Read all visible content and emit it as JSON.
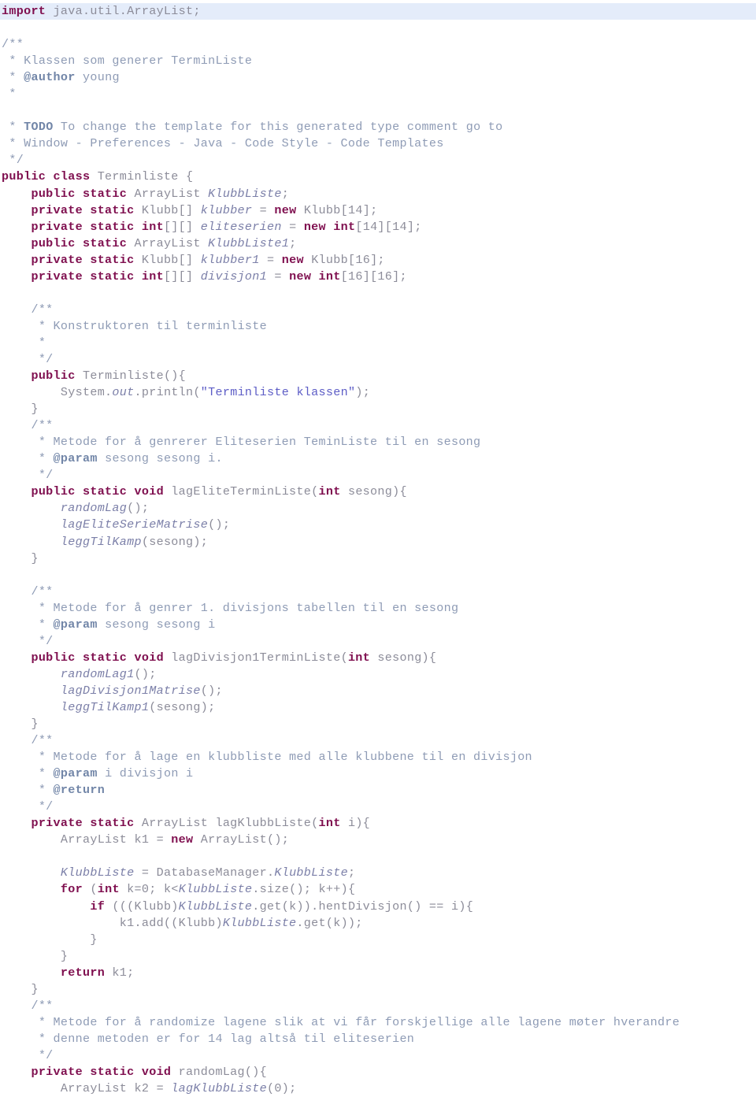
{
  "document": {
    "kind": "java-source-listing",
    "language": "Java",
    "class_name": "Terminliste",
    "author": "young",
    "colors": {
      "background": "#ffffff",
      "highlight_line": "#e4ecfa",
      "keyword": "#7f0f4f",
      "plain": "#8c8c99",
      "field_italic": "#7b7fa8",
      "comment": "#8e9bb5",
      "comment_tag": "#7286a8",
      "string": "#5d5dc6"
    },
    "highlighted_line_index": 0
  },
  "lines": [
    {
      "i": 0,
      "hl": true,
      "tokens": [
        {
          "t": "kw",
          "v": "import"
        },
        {
          "t": "pln",
          "v": " java.util.ArrayList;"
        }
      ]
    },
    {
      "i": 1,
      "tokens": []
    },
    {
      "i": 2,
      "tokens": [
        {
          "t": "cmt",
          "v": "/**"
        }
      ]
    },
    {
      "i": 3,
      "tokens": [
        {
          "t": "cmt",
          "v": " * Klassen som generer TerminListe"
        }
      ]
    },
    {
      "i": 4,
      "tokens": [
        {
          "t": "cmt",
          "v": " * "
        },
        {
          "t": "cmtb",
          "v": "@author"
        },
        {
          "t": "cmt",
          "v": " young"
        }
      ]
    },
    {
      "i": 5,
      "tokens": [
        {
          "t": "cmt",
          "v": " *"
        }
      ]
    },
    {
      "i": 6,
      "tokens": []
    },
    {
      "i": 7,
      "tokens": [
        {
          "t": "cmt",
          "v": " * "
        },
        {
          "t": "cmtb",
          "v": "TODO"
        },
        {
          "t": "cmt",
          "v": " To change the template for this generated type comment go to"
        }
      ]
    },
    {
      "i": 8,
      "tokens": [
        {
          "t": "cmt",
          "v": " * Window - Preferences - Java - Code Style - Code Templates"
        }
      ]
    },
    {
      "i": 9,
      "tokens": [
        {
          "t": "cmt",
          "v": " */"
        }
      ]
    },
    {
      "i": 10,
      "tokens": [
        {
          "t": "kw",
          "v": "public class"
        },
        {
          "t": "pln",
          "v": " Terminliste {"
        }
      ]
    },
    {
      "i": 11,
      "tokens": [
        {
          "t": "pln",
          "v": "    "
        },
        {
          "t": "kw",
          "v": "public static"
        },
        {
          "t": "pln",
          "v": " ArrayList "
        },
        {
          "t": "fld",
          "v": "KlubbListe"
        },
        {
          "t": "pln",
          "v": ";"
        }
      ]
    },
    {
      "i": 12,
      "tokens": [
        {
          "t": "pln",
          "v": "    "
        },
        {
          "t": "kw",
          "v": "private static"
        },
        {
          "t": "pln",
          "v": " Klubb[] "
        },
        {
          "t": "fld",
          "v": "klubber"
        },
        {
          "t": "pln",
          "v": " = "
        },
        {
          "t": "kw",
          "v": "new"
        },
        {
          "t": "pln",
          "v": " Klubb[14];"
        }
      ]
    },
    {
      "i": 13,
      "tokens": [
        {
          "t": "pln",
          "v": "    "
        },
        {
          "t": "kw",
          "v": "private static int"
        },
        {
          "t": "pln",
          "v": "[][] "
        },
        {
          "t": "fld",
          "v": "eliteserien"
        },
        {
          "t": "pln",
          "v": " = "
        },
        {
          "t": "kw",
          "v": "new int"
        },
        {
          "t": "pln",
          "v": "[14][14];"
        }
      ]
    },
    {
      "i": 14,
      "tokens": [
        {
          "t": "pln",
          "v": "    "
        },
        {
          "t": "kw",
          "v": "public static"
        },
        {
          "t": "pln",
          "v": " ArrayList "
        },
        {
          "t": "fld",
          "v": "KlubbListe1"
        },
        {
          "t": "pln",
          "v": ";"
        }
      ]
    },
    {
      "i": 15,
      "tokens": [
        {
          "t": "pln",
          "v": "    "
        },
        {
          "t": "kw",
          "v": "private static"
        },
        {
          "t": "pln",
          "v": " Klubb[] "
        },
        {
          "t": "fld",
          "v": "klubber1"
        },
        {
          "t": "pln",
          "v": " = "
        },
        {
          "t": "kw",
          "v": "new"
        },
        {
          "t": "pln",
          "v": " Klubb[16];"
        }
      ]
    },
    {
      "i": 16,
      "tokens": [
        {
          "t": "pln",
          "v": "    "
        },
        {
          "t": "kw",
          "v": "private static int"
        },
        {
          "t": "pln",
          "v": "[][] "
        },
        {
          "t": "fld",
          "v": "divisjon1"
        },
        {
          "t": "pln",
          "v": " = "
        },
        {
          "t": "kw",
          "v": "new int"
        },
        {
          "t": "pln",
          "v": "[16][16];"
        }
      ]
    },
    {
      "i": 17,
      "tokens": []
    },
    {
      "i": 18,
      "tokens": [
        {
          "t": "cmt",
          "v": "    /**"
        }
      ]
    },
    {
      "i": 19,
      "tokens": [
        {
          "t": "cmt",
          "v": "     * Konstruktoren til terminliste"
        }
      ]
    },
    {
      "i": 20,
      "tokens": [
        {
          "t": "cmt",
          "v": "     *"
        }
      ]
    },
    {
      "i": 21,
      "tokens": [
        {
          "t": "cmt",
          "v": "     */"
        }
      ]
    },
    {
      "i": 22,
      "tokens": [
        {
          "t": "pln",
          "v": "    "
        },
        {
          "t": "kw",
          "v": "public"
        },
        {
          "t": "pln",
          "v": " Terminliste(){"
        }
      ]
    },
    {
      "i": 23,
      "tokens": [
        {
          "t": "pln",
          "v": "        System."
        },
        {
          "t": "fld",
          "v": "out"
        },
        {
          "t": "pln",
          "v": ".println("
        },
        {
          "t": "str",
          "v": "\"Terminliste klassen\""
        },
        {
          "t": "pln",
          "v": ");"
        }
      ]
    },
    {
      "i": 24,
      "tokens": [
        {
          "t": "pln",
          "v": "    }"
        }
      ]
    },
    {
      "i": 25,
      "tokens": [
        {
          "t": "cmt",
          "v": "    /**"
        }
      ]
    },
    {
      "i": 26,
      "tokens": [
        {
          "t": "cmt",
          "v": "     * Metode for å genrerer Eliteserien TeminListe til en sesong"
        }
      ]
    },
    {
      "i": 27,
      "tokens": [
        {
          "t": "cmt",
          "v": "     * "
        },
        {
          "t": "cmtb",
          "v": "@param"
        },
        {
          "t": "cmt",
          "v": " sesong sesong i."
        }
      ]
    },
    {
      "i": 28,
      "tokens": [
        {
          "t": "cmt",
          "v": "     */"
        }
      ]
    },
    {
      "i": 29,
      "tokens": [
        {
          "t": "pln",
          "v": "    "
        },
        {
          "t": "kw",
          "v": "public static void"
        },
        {
          "t": "pln",
          "v": " lagEliteTerminListe("
        },
        {
          "t": "kw",
          "v": "int"
        },
        {
          "t": "pln",
          "v": " sesong){"
        }
      ]
    },
    {
      "i": 30,
      "tokens": [
        {
          "t": "pln",
          "v": "        "
        },
        {
          "t": "fld",
          "v": "randomLag"
        },
        {
          "t": "pln",
          "v": "();"
        }
      ]
    },
    {
      "i": 31,
      "tokens": [
        {
          "t": "pln",
          "v": "        "
        },
        {
          "t": "fld",
          "v": "lagEliteSerieMatrise"
        },
        {
          "t": "pln",
          "v": "();"
        }
      ]
    },
    {
      "i": 32,
      "tokens": [
        {
          "t": "pln",
          "v": "        "
        },
        {
          "t": "fld",
          "v": "leggTilKamp"
        },
        {
          "t": "pln",
          "v": "(sesong);"
        }
      ]
    },
    {
      "i": 33,
      "tokens": [
        {
          "t": "pln",
          "v": "    }"
        }
      ]
    },
    {
      "i": 34,
      "tokens": []
    },
    {
      "i": 35,
      "tokens": [
        {
          "t": "cmt",
          "v": "    /**"
        }
      ]
    },
    {
      "i": 36,
      "tokens": [
        {
          "t": "cmt",
          "v": "     * Metode for å genrer 1. divisjons tabellen til en sesong"
        }
      ]
    },
    {
      "i": 37,
      "tokens": [
        {
          "t": "cmt",
          "v": "     * "
        },
        {
          "t": "cmtb",
          "v": "@param"
        },
        {
          "t": "cmt",
          "v": " sesong sesong i"
        }
      ]
    },
    {
      "i": 38,
      "tokens": [
        {
          "t": "cmt",
          "v": "     */"
        }
      ]
    },
    {
      "i": 39,
      "tokens": [
        {
          "t": "pln",
          "v": "    "
        },
        {
          "t": "kw",
          "v": "public static void"
        },
        {
          "t": "pln",
          "v": " lagDivisjon1TerminListe("
        },
        {
          "t": "kw",
          "v": "int"
        },
        {
          "t": "pln",
          "v": " sesong){"
        }
      ]
    },
    {
      "i": 40,
      "tokens": [
        {
          "t": "pln",
          "v": "        "
        },
        {
          "t": "fld",
          "v": "randomLag1"
        },
        {
          "t": "pln",
          "v": "();"
        }
      ]
    },
    {
      "i": 41,
      "tokens": [
        {
          "t": "pln",
          "v": "        "
        },
        {
          "t": "fld",
          "v": "lagDivisjon1Matrise"
        },
        {
          "t": "pln",
          "v": "();"
        }
      ]
    },
    {
      "i": 42,
      "tokens": [
        {
          "t": "pln",
          "v": "        "
        },
        {
          "t": "fld",
          "v": "leggTilKamp1"
        },
        {
          "t": "pln",
          "v": "(sesong);"
        }
      ]
    },
    {
      "i": 43,
      "tokens": [
        {
          "t": "pln",
          "v": "    }"
        }
      ]
    },
    {
      "i": 44,
      "tokens": [
        {
          "t": "cmt",
          "v": "    /**"
        }
      ]
    },
    {
      "i": 45,
      "tokens": [
        {
          "t": "cmt",
          "v": "     * Metode for å lage en klubbliste med alle klubbene til en divisjon"
        }
      ]
    },
    {
      "i": 46,
      "tokens": [
        {
          "t": "cmt",
          "v": "     * "
        },
        {
          "t": "cmtb",
          "v": "@param"
        },
        {
          "t": "cmt",
          "v": " i divisjon i"
        }
      ]
    },
    {
      "i": 47,
      "tokens": [
        {
          "t": "cmt",
          "v": "     * "
        },
        {
          "t": "cmtb",
          "v": "@return"
        }
      ]
    },
    {
      "i": 48,
      "tokens": [
        {
          "t": "cmt",
          "v": "     */"
        }
      ]
    },
    {
      "i": 49,
      "tokens": [
        {
          "t": "pln",
          "v": "    "
        },
        {
          "t": "kw",
          "v": "private static"
        },
        {
          "t": "pln",
          "v": " ArrayList lagKlubbListe("
        },
        {
          "t": "kw",
          "v": "int"
        },
        {
          "t": "pln",
          "v": " i){"
        }
      ]
    },
    {
      "i": 50,
      "tokens": [
        {
          "t": "pln",
          "v": "        ArrayList k1 = "
        },
        {
          "t": "kw",
          "v": "new"
        },
        {
          "t": "pln",
          "v": " ArrayList();"
        }
      ]
    },
    {
      "i": 51,
      "tokens": []
    },
    {
      "i": 52,
      "tokens": [
        {
          "t": "pln",
          "v": "        "
        },
        {
          "t": "fld",
          "v": "KlubbListe"
        },
        {
          "t": "pln",
          "v": " = DatabaseManager."
        },
        {
          "t": "fld",
          "v": "KlubbListe"
        },
        {
          "t": "pln",
          "v": ";"
        }
      ]
    },
    {
      "i": 53,
      "tokens": [
        {
          "t": "pln",
          "v": "        "
        },
        {
          "t": "kw",
          "v": "for"
        },
        {
          "t": "pln",
          "v": " ("
        },
        {
          "t": "kw",
          "v": "int"
        },
        {
          "t": "pln",
          "v": " k=0; k<"
        },
        {
          "t": "fld",
          "v": "KlubbListe"
        },
        {
          "t": "pln",
          "v": ".size(); k++){"
        }
      ]
    },
    {
      "i": 54,
      "tokens": [
        {
          "t": "pln",
          "v": "            "
        },
        {
          "t": "kw",
          "v": "if"
        },
        {
          "t": "pln",
          "v": " (((Klubb)"
        },
        {
          "t": "fld",
          "v": "KlubbListe"
        },
        {
          "t": "pln",
          "v": ".get(k)).hentDivisjon() == i){"
        }
      ]
    },
    {
      "i": 55,
      "tokens": [
        {
          "t": "pln",
          "v": "                k1.add((Klubb)"
        },
        {
          "t": "fld",
          "v": "KlubbListe"
        },
        {
          "t": "pln",
          "v": ".get(k));"
        }
      ]
    },
    {
      "i": 56,
      "tokens": [
        {
          "t": "pln",
          "v": "            }"
        }
      ]
    },
    {
      "i": 57,
      "tokens": [
        {
          "t": "pln",
          "v": "        }"
        }
      ]
    },
    {
      "i": 58,
      "tokens": [
        {
          "t": "pln",
          "v": "        "
        },
        {
          "t": "kw",
          "v": "return"
        },
        {
          "t": "pln",
          "v": " k1;"
        }
      ]
    },
    {
      "i": 59,
      "tokens": [
        {
          "t": "pln",
          "v": "    }"
        }
      ]
    },
    {
      "i": 60,
      "tokens": [
        {
          "t": "cmt",
          "v": "    /**"
        }
      ]
    },
    {
      "i": 61,
      "tokens": [
        {
          "t": "cmt",
          "v": "     * Metode for å randomize lagene slik at vi får forskjellige alle lagene møter hverandre"
        }
      ]
    },
    {
      "i": 62,
      "tokens": [
        {
          "t": "cmt",
          "v": "     * denne metoden er for 14 lag altså til eliteserien"
        }
      ]
    },
    {
      "i": 63,
      "tokens": [
        {
          "t": "cmt",
          "v": "     */"
        }
      ]
    },
    {
      "i": 64,
      "tokens": [
        {
          "t": "pln",
          "v": "    "
        },
        {
          "t": "kw",
          "v": "private static void"
        },
        {
          "t": "pln",
          "v": " randomLag(){"
        }
      ]
    },
    {
      "i": 65,
      "tokens": [
        {
          "t": "pln",
          "v": "        ArrayList k2 = "
        },
        {
          "t": "fld",
          "v": "lagKlubbListe"
        },
        {
          "t": "pln",
          "v": "(0);"
        }
      ]
    }
  ]
}
